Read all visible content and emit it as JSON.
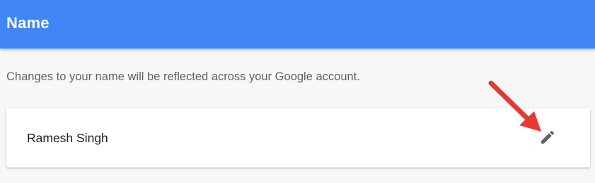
{
  "header": {
    "title": "Name"
  },
  "description": "Changes to your name will be reflected across your Google account.",
  "name_card": {
    "name": "Ramesh Singh",
    "edit_icon": "pencil-icon"
  },
  "annotation": {
    "icon": "red-arrow",
    "color": "#e53935"
  },
  "colors": {
    "header_bg": "#4285f4",
    "page_bg": "#f7f7f7",
    "card_bg": "#ffffff",
    "icon": "#5f6368"
  }
}
